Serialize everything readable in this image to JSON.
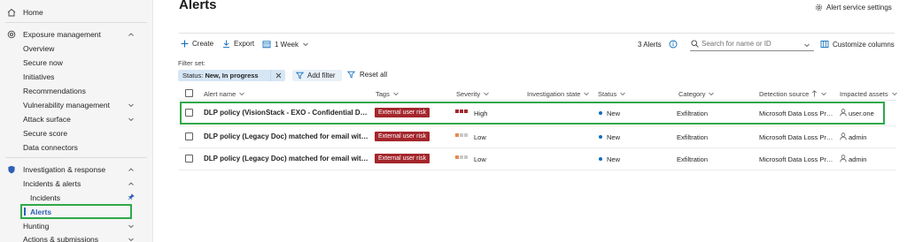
{
  "sidebar": {
    "home": "Home",
    "exposure_management": "Exposure management",
    "overview": "Overview",
    "secure_now": "Secure now",
    "initiatives": "Initiatives",
    "recommendations": "Recommendations",
    "vulnerability_management": "Vulnerability management",
    "attack_surface": "Attack surface",
    "secure_score": "Secure score",
    "data_connectors": "Data connectors",
    "investigation_response": "Investigation & response",
    "incidents_alerts": "Incidents & alerts",
    "incidents": "Incidents",
    "alerts": "Alerts",
    "hunting": "Hunting",
    "actions_submissions": "Actions & submissions"
  },
  "header": {
    "title": "Alerts",
    "service_settings": "Alert service settings"
  },
  "toolbar": {
    "create": "Create",
    "export": "Export",
    "time_range": "1 Week",
    "count": "3 Alerts",
    "search_placeholder": "Search for name or ID",
    "customize": "Customize columns"
  },
  "filters": {
    "label": "Filter set:",
    "chip_prefix": "Status: ",
    "chip_value": "New, In progress",
    "add_filter": "Add filter",
    "reset_all": "Reset all"
  },
  "columns": [
    "Alert name",
    "Tags",
    "Severity",
    "Investigation state",
    "Status",
    "Category",
    "Detection source",
    "Impacted assets"
  ],
  "rows": [
    {
      "name": "DLP policy (VisionStack - EXO - Confidential Data ...",
      "tag": "External user risk",
      "severity": "High",
      "status": "New",
      "category": "Exfiltration",
      "source": "Microsoft Data Loss Preve...",
      "asset": "user.one"
    },
    {
      "name": "DLP policy (Legacy Doc) matched for email with s...",
      "tag": "External user risk",
      "severity": "Low",
      "status": "New",
      "category": "Exfiltration",
      "source": "Microsoft Data Loss Preve...",
      "asset": "admin"
    },
    {
      "name": "DLP policy (Legacy Doc) matched for email with s...",
      "tag": "External user risk",
      "severity": "Low",
      "status": "New",
      "category": "Exfiltration",
      "source": "Microsoft Data Loss Preve...",
      "asset": "admin"
    }
  ],
  "colors": {
    "accent": "#0f6cbd",
    "tag_bg": "#a4262c",
    "highlight": "#2fa84a",
    "severity_high": "#a4262c",
    "severity_low": "#e8884d"
  }
}
